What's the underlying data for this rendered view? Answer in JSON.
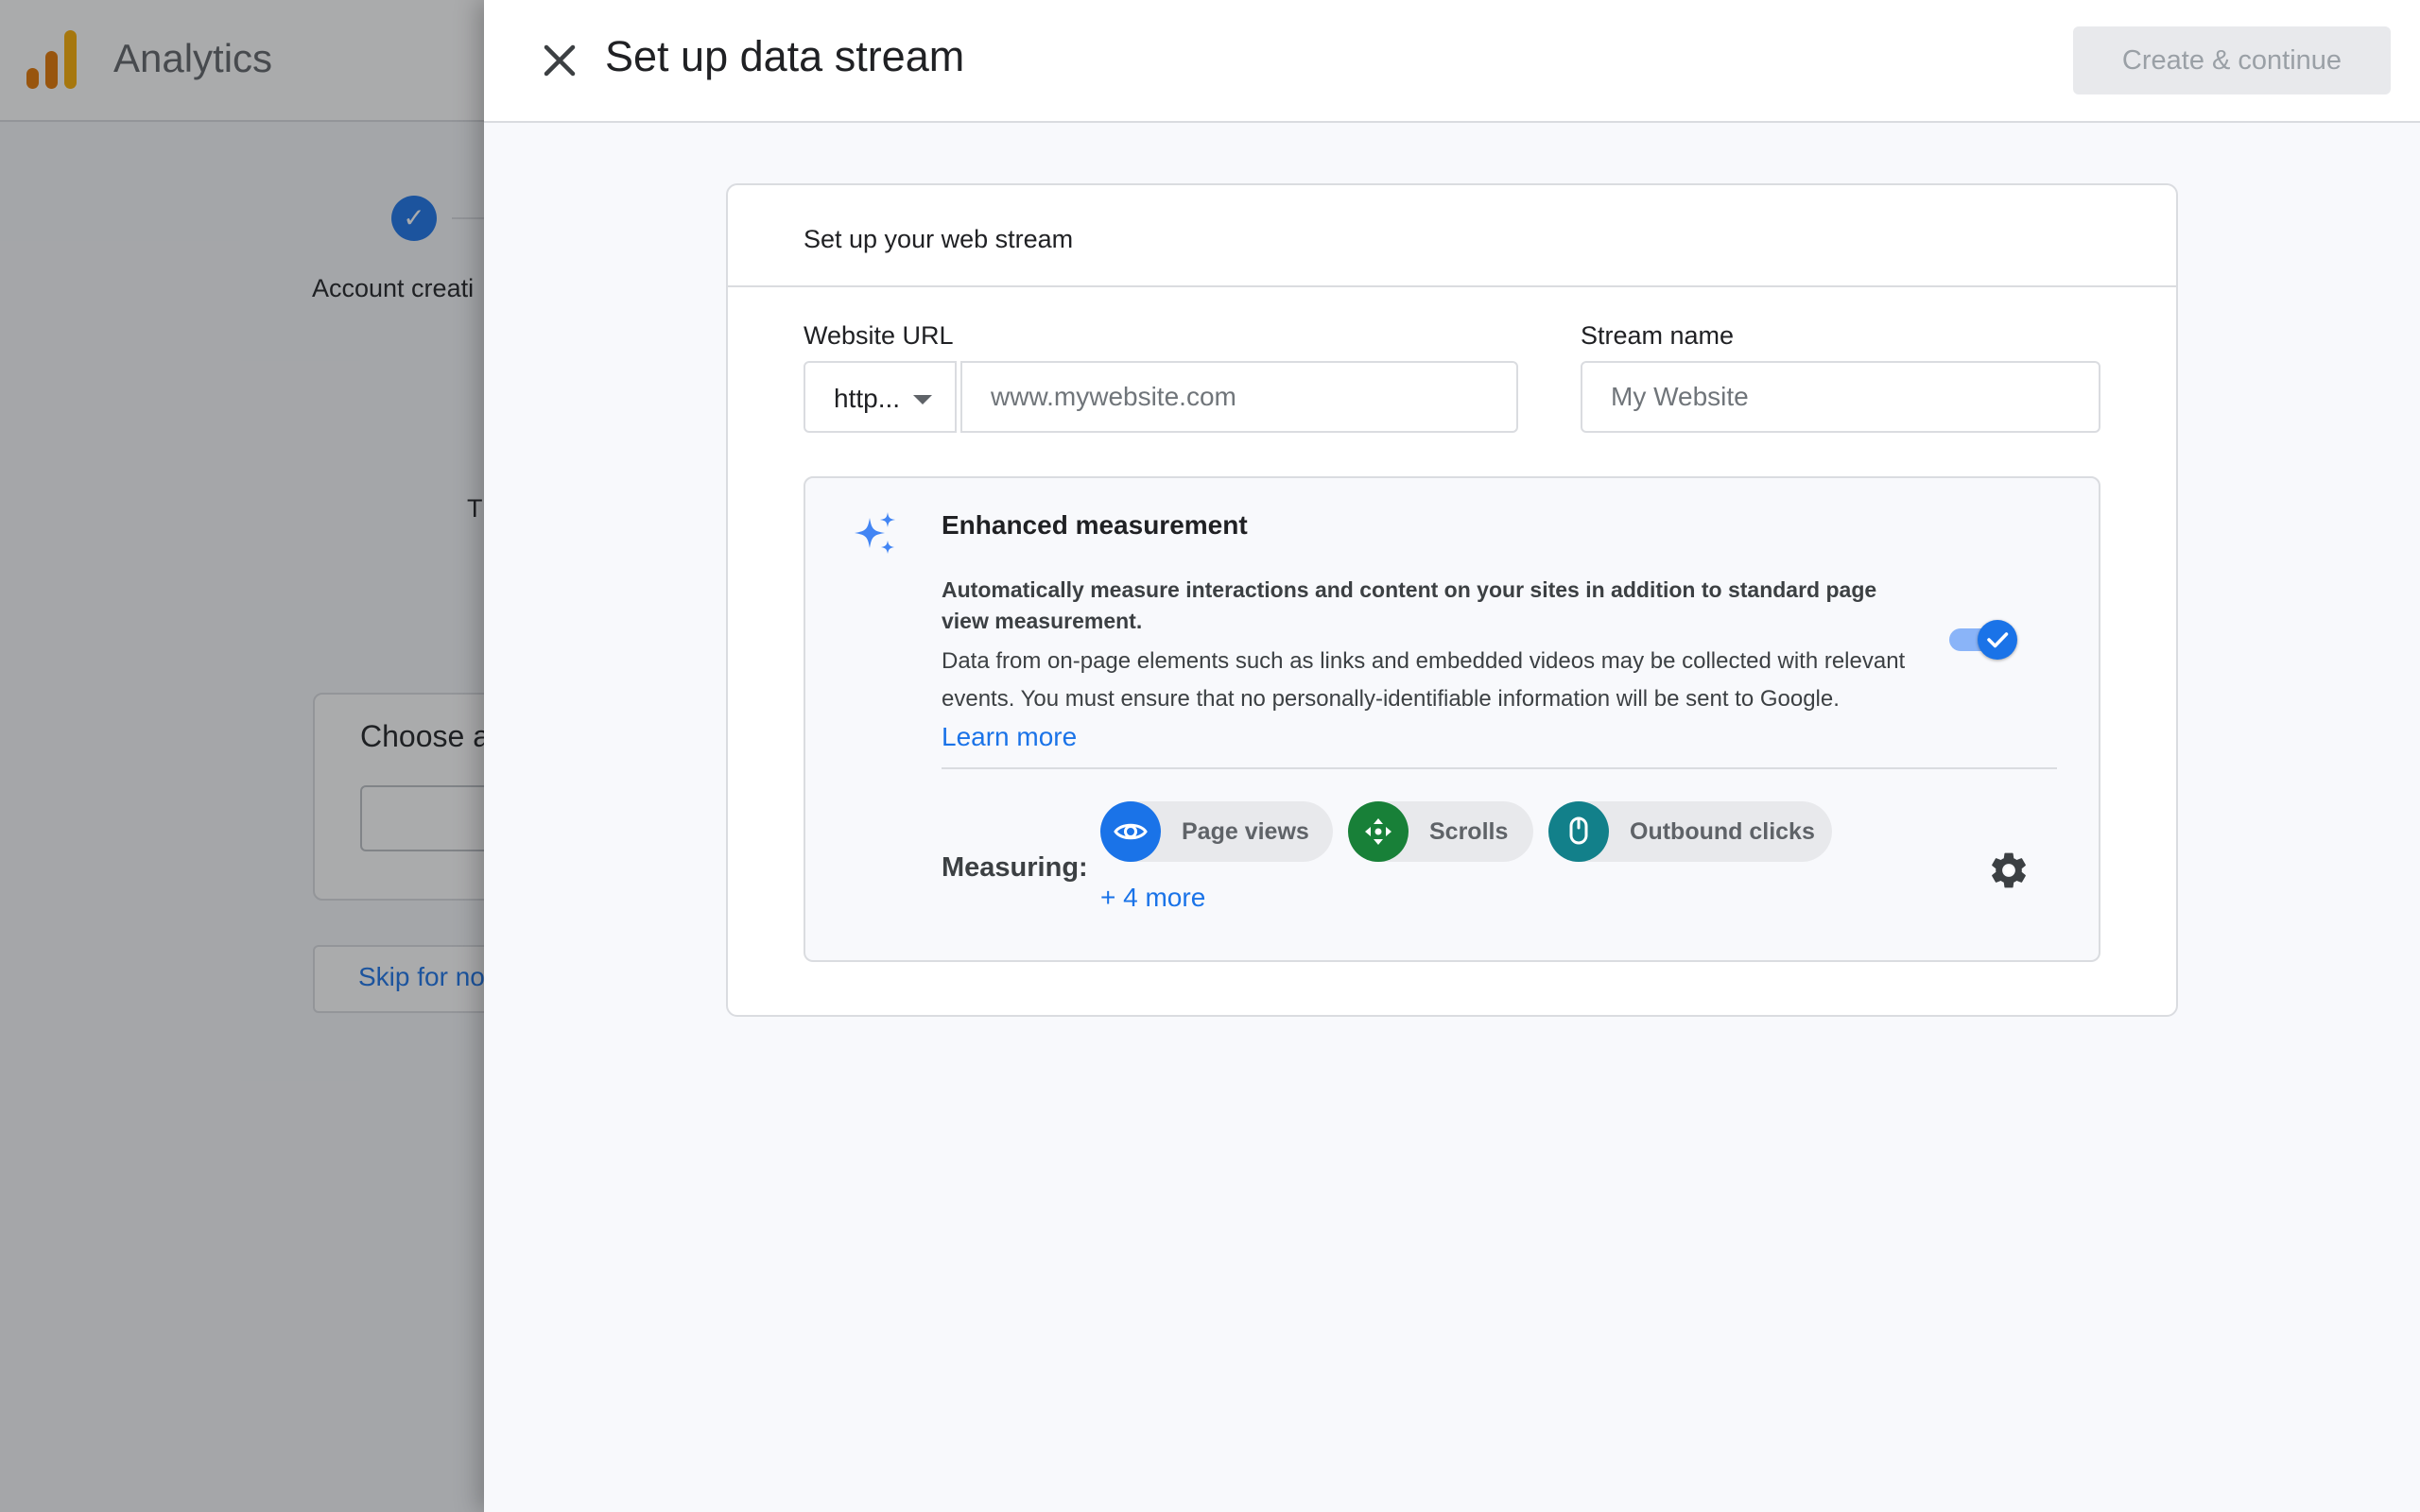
{
  "background_page": {
    "app_title": "Analytics",
    "step_label": "Account creati",
    "fragment_text": "T",
    "card_title": "Choose a",
    "skip_label": "Skip for no"
  },
  "header": {
    "close_icon": "close-icon",
    "title": "Set up data stream",
    "create_label": "Create & continue"
  },
  "card": {
    "title": "Set up your web stream",
    "website_url_label": "Website URL",
    "protocol_value": "http...",
    "url_placeholder": "www.mywebsite.com",
    "stream_name_label": "Stream name",
    "stream_name_placeholder": "My Website"
  },
  "enhanced": {
    "icon": "sparkle-icon",
    "title": "Enhanced measurement",
    "bold_text": "Automatically measure interactions and content on your sites in addition to standard page view measurement.",
    "description": "Data from on-page elements such as links and embedded videos may be collected with relevant events. You must ensure that no personally-identifiable information will be sent to Google.",
    "learn_more": "Learn more",
    "toggle_on": true,
    "measuring_label": "Measuring:",
    "chips": [
      {
        "label": "Page views",
        "icon": "eye-icon",
        "color": "#1a73e8"
      },
      {
        "label": "Scrolls",
        "icon": "scroll-icon",
        "color": "#188038"
      },
      {
        "label": "Outbound clicks",
        "icon": "mouse-icon",
        "color": "#12808a"
      }
    ],
    "more_label": "+ 4 more",
    "settings_icon": "gear-icon"
  },
  "colors": {
    "accent": "#1a73e8",
    "logo_orange": "#f9ab00",
    "logo_dark_orange": "#e37400"
  }
}
